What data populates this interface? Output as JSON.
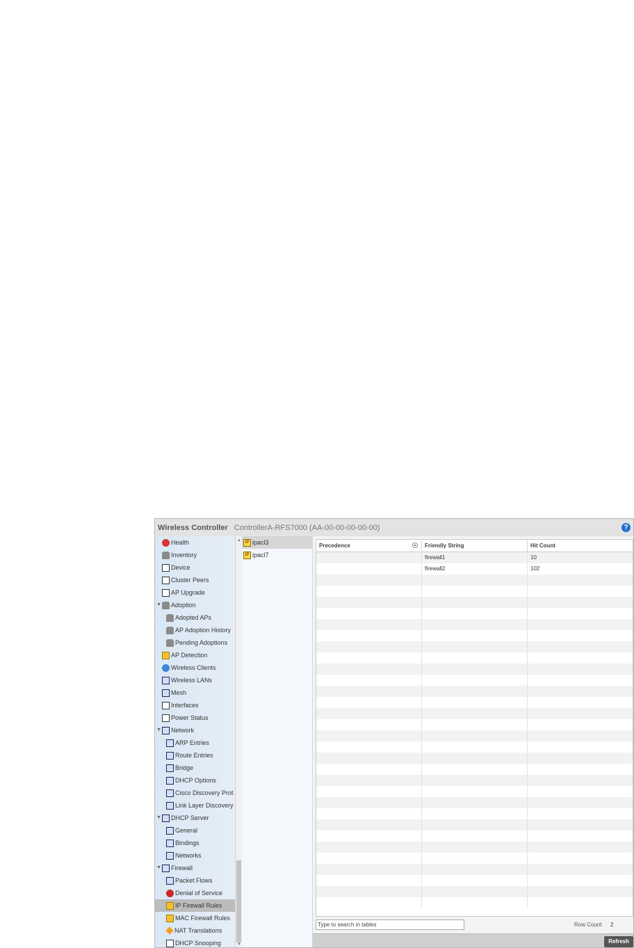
{
  "header": {
    "app_title": "Wireless Controller",
    "device": "ControllerA-RFS7000 (AA-00-00-00-00-00)",
    "help_icon": "?"
  },
  "nav": {
    "items": [
      {
        "label": "Health",
        "level": 0,
        "icon": "health-icon"
      },
      {
        "label": "Inventory",
        "level": 0,
        "icon": "inventory-icon"
      },
      {
        "label": "Device",
        "level": 0,
        "icon": "device-icon"
      },
      {
        "label": "Cluster Peers",
        "level": 0,
        "icon": "cluster-peers-icon"
      },
      {
        "label": "AP Upgrade",
        "level": 0,
        "icon": "ap-upgrade-icon"
      },
      {
        "label": "Adoption",
        "level": 0,
        "icon": "adoption-icon",
        "expanded": true
      },
      {
        "label": "Adopted APs",
        "level": 1,
        "icon": "adopted-aps-icon"
      },
      {
        "label": "AP Adoption History",
        "level": 1,
        "icon": "ap-adoption-history-icon"
      },
      {
        "label": "Pending Adoptions",
        "level": 1,
        "icon": "pending-adoptions-icon"
      },
      {
        "label": "AP Detection",
        "level": 0,
        "icon": "ap-detection-icon"
      },
      {
        "label": "Wireless Clients",
        "level": 0,
        "icon": "wireless-clients-icon"
      },
      {
        "label": "Wireless LANs",
        "level": 0,
        "icon": "wireless-lans-icon"
      },
      {
        "label": "Mesh",
        "level": 0,
        "icon": "mesh-icon"
      },
      {
        "label": "Interfaces",
        "level": 0,
        "icon": "interfaces-icon"
      },
      {
        "label": "Power Status",
        "level": 0,
        "icon": "power-status-icon"
      },
      {
        "label": "Network",
        "level": 0,
        "icon": "network-icon",
        "expanded": true
      },
      {
        "label": "ARP Entries",
        "level": 1,
        "icon": "arp-entries-icon"
      },
      {
        "label": "Route Entries",
        "level": 1,
        "icon": "route-entries-icon"
      },
      {
        "label": "Bridge",
        "level": 1,
        "icon": "bridge-icon"
      },
      {
        "label": "DHCP Options",
        "level": 1,
        "icon": "dhcp-options-icon"
      },
      {
        "label": "Cisco Discovery Prot",
        "level": 1,
        "icon": "cisco-discovery-icon"
      },
      {
        "label": "Link Layer Discovery",
        "level": 1,
        "icon": "link-layer-discovery-icon"
      },
      {
        "label": "DHCP Server",
        "level": 0,
        "icon": "dhcp-server-icon",
        "expanded": true
      },
      {
        "label": "General",
        "level": 1,
        "icon": "general-icon"
      },
      {
        "label": "Bindings",
        "level": 1,
        "icon": "bindings-icon"
      },
      {
        "label": "Networks",
        "level": 1,
        "icon": "networks-icon"
      },
      {
        "label": "Firewall",
        "level": 0,
        "icon": "firewall-icon",
        "expanded": true
      },
      {
        "label": "Packet Flows",
        "level": 1,
        "icon": "packet-flows-icon"
      },
      {
        "label": "Denial of Service",
        "level": 1,
        "icon": "denial-of-service-icon"
      },
      {
        "label": "IP Firewall Rules",
        "level": 1,
        "icon": "ip-firewall-rules-icon",
        "selected": true
      },
      {
        "label": "MAC Firewall Rules",
        "level": 1,
        "icon": "mac-firewall-rules-icon"
      },
      {
        "label": "NAT Translations",
        "level": 1,
        "icon": "nat-translations-icon"
      },
      {
        "label": "DHCP Snooping",
        "level": 1,
        "icon": "dhcp-snooping-icon"
      }
    ]
  },
  "acl_list": {
    "items": [
      {
        "label": "ipacl3",
        "selected": true
      },
      {
        "label": "ipacl7",
        "selected": false
      }
    ]
  },
  "table": {
    "columns": [
      "Precedence",
      "Friendly String",
      "Hit Count"
    ],
    "rows": [
      [
        "",
        "firewall1",
        "10"
      ],
      [
        "",
        "firewall2",
        "102"
      ]
    ]
  },
  "footer": {
    "search_placeholder": "Type to search in tables",
    "row_count_label": "Row Count",
    "row_count_value": "2",
    "refresh_label": "Refresh"
  },
  "colors": {
    "accent": "#1f6fd1",
    "nav_bg": "#d9e7f4",
    "selected": "#bcbcbc"
  }
}
